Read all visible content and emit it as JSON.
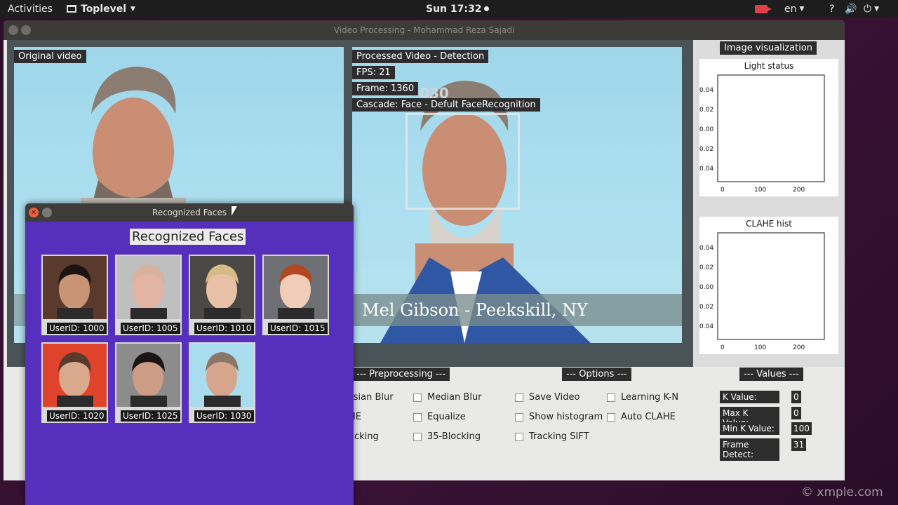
{
  "topbar": {
    "activities": "Activities",
    "app_menu": "Toplevel",
    "clock": "Sun 17:32",
    "language": "en"
  },
  "main_window": {
    "title": "Video Processing - Mohammad Reza Sajadi",
    "original_label": "Original video",
    "processed_label": "Processed Video - Detection",
    "fps": "FPS: 21",
    "frame": "Frame: 1360",
    "cascade": "Cascade: Face - Defult FaceRecognition",
    "banner_text": "Mel Gibson - Peekskill, NY",
    "detected_id": "030"
  },
  "visualization": {
    "title": "Image visualization",
    "plots": [
      {
        "title": "Light status",
        "y_ticks": [
          "0.04",
          "0.02",
          "0.00",
          "0.02",
          "0.04"
        ],
        "x_ticks": [
          "0",
          "100",
          "200"
        ]
      },
      {
        "title": "CLAHE hist",
        "y_ticks": [
          "0.04",
          "0.02",
          "0.00",
          "0.02",
          "0.04"
        ],
        "x_ticks": [
          "0",
          "100",
          "200"
        ]
      }
    ]
  },
  "preprocessing": {
    "title": "--- Preprocessing ---",
    "col1": [
      "ssian Blur",
      "HE",
      "ocking"
    ],
    "col2": [
      "Median Blur",
      "Equalize",
      "35-Blocking"
    ]
  },
  "options": {
    "title": "--- Options ---",
    "col1": [
      "Save Video",
      "Show histogram",
      "Tracking SIFT"
    ],
    "col2": [
      "Learning K-N",
      "Auto CLAHE"
    ]
  },
  "values": {
    "title": "--- Values ---",
    "rows": [
      {
        "label": "K Value:",
        "value": "0"
      },
      {
        "label": "Max K Value:",
        "value": "0"
      },
      {
        "label": "Min K Value:",
        "value": "100"
      },
      {
        "label": "Frame Detect:",
        "value": "31"
      }
    ]
  },
  "faces_window": {
    "title": "Recognized Faces",
    "heading": "Recognized Faces",
    "faces": [
      {
        "label": "UserID: 1000",
        "bg": "#5a3a2c",
        "skin": "#c99375",
        "hair": "#1b1411"
      },
      {
        "label": "UserID: 1005",
        "bg": "#bfbfbf",
        "skin": "#e3b4a3",
        "hair": "#d8b29f"
      },
      {
        "label": "UserID: 1010",
        "bg": "#4a4845",
        "skin": "#e8c1a7",
        "hair": "#d6bb86"
      },
      {
        "label": "UserID: 1015",
        "bg": "#6d6f73",
        "skin": "#f1cdb8",
        "hair": "#b5461f"
      },
      {
        "label": "UserID: 1020",
        "bg": "#e0432b",
        "skin": "#d9a98d",
        "hair": "#5a3a2a"
      },
      {
        "label": "UserID: 1025",
        "bg": "#8c8c8c",
        "skin": "#cc9c84",
        "hair": "#1a1412"
      },
      {
        "label": "UserID: 1030",
        "bg": "#a9dcec",
        "skin": "#d7a58c",
        "hair": "#8a7566"
      }
    ]
  },
  "watermark": "© xmple.com"
}
